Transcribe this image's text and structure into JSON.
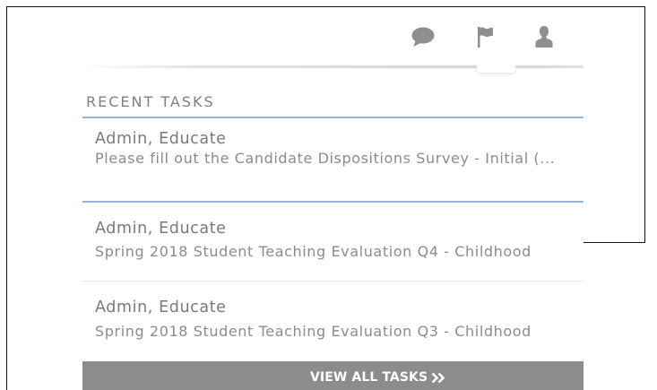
{
  "header": {
    "icons": [
      "chat-bubble-icon",
      "flag-icon",
      "user-icon"
    ]
  },
  "recent_tasks": {
    "title": "RECENT TASKS",
    "items": [
      {
        "assignee": "Admin, Educate",
        "task": "Please fill out the Candidate Dispositions Survey - Initial (...",
        "highlighted": true
      },
      {
        "assignee": "Admin, Educate",
        "task": "Spring 2018 Student Teaching Evaluation Q4 - Childhood",
        "highlighted": false
      },
      {
        "assignee": "Admin, Educate",
        "task": "Spring 2018 Student Teaching Evaluation Q3 - Childhood",
        "highlighted": false
      }
    ],
    "view_all": {
      "label": "VIEW ALL TASKS",
      "icon": "double-chevron-right-icon"
    }
  },
  "colors": {
    "accent_blue": "#8fb6e2",
    "footer_bar": "#8c8c8c",
    "icon_gray": "#8f8f8f",
    "text_gray": "#7a7a7a"
  }
}
